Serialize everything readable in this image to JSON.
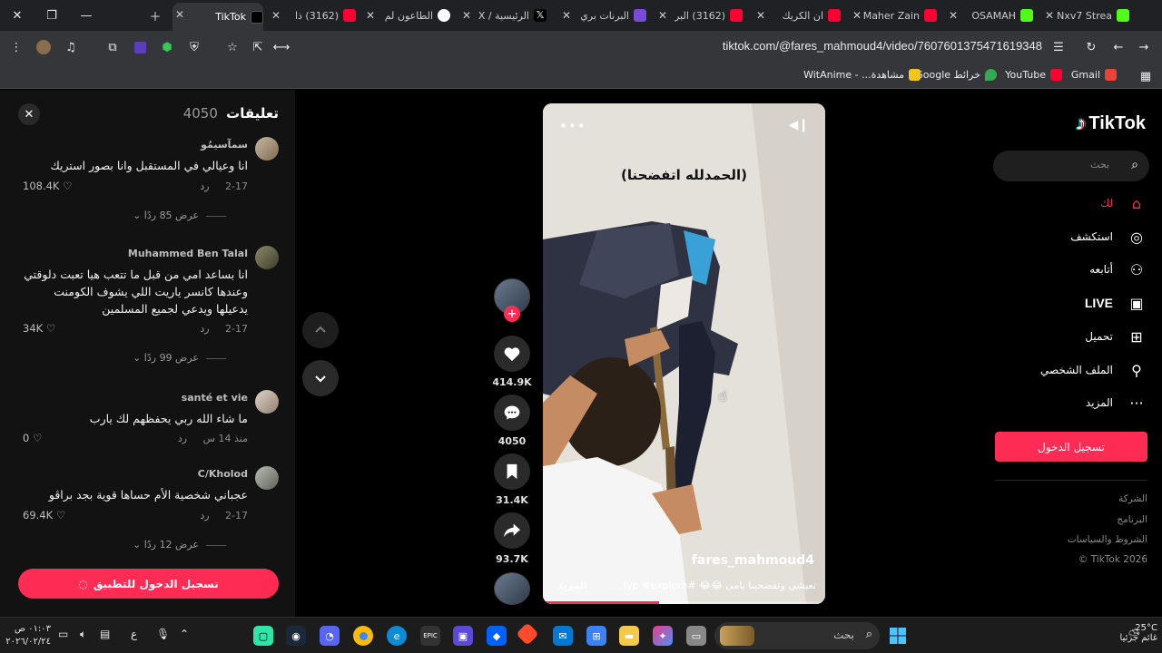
{
  "browser": {
    "tabs": [
      {
        "title": "Nxv7 Strea",
        "color": "#53fc18"
      },
      {
        "title": "OSAMAH",
        "color": "#53fc18"
      },
      {
        "title": "Maher Zain",
        "color": "#ff0033"
      },
      {
        "title": "ان الكريك",
        "color": "#ff0033"
      },
      {
        "title": "(3162) البر",
        "color": "#ff0033"
      },
      {
        "title": "البرنات بري",
        "color": "#7a4bd8"
      },
      {
        "title": "الرئيسية / X",
        "color": "#ffffff"
      },
      {
        "title": "الطاعون لم",
        "color": "#4285f4"
      },
      {
        "title": "(3162) ذا",
        "color": "#ff0033"
      },
      {
        "title": "TikTok",
        "color": "#000000"
      }
    ],
    "active_tab": "TikTok",
    "url": "tiktok.com/@fares_mahmoud4/video/7607601375471619348",
    "bookmarks": [
      {
        "label": "Gmail",
        "color": "#ea4335"
      },
      {
        "label": "YouTube",
        "color": "#ff0033"
      },
      {
        "label": "خرائط Google",
        "color": "#34a853"
      },
      {
        "label": "مشاهدة... - WitAnime",
        "color": "#f5c518"
      }
    ]
  },
  "comments_panel": {
    "title": "تعليقات",
    "count": "4050",
    "comments": [
      {
        "user": "سمآسيمُو",
        "text": "انا وعيالي في المستقبل وانا بصور استريك",
        "date": "2-17",
        "reply": "رد",
        "likes": "108.4K",
        "replies": "عرض 85 ردًا"
      },
      {
        "user": "Muhammed Ben Talal",
        "text": "انا بساعد امي من قبل ما تتعب هيا تعبت دلوقتي وعندها كانسر ياريت اللي يشوف الكومنت يدعيلها ويدعي لجميع المسلمين",
        "date": "2-17",
        "reply": "رد",
        "likes": "34K",
        "replies": "عرض 99 ردًا"
      },
      {
        "user": "santé et vie",
        "text": "ما شاء الله ربي يحفظهم لك يارب",
        "date": "منذ 14 س",
        "reply": "رد",
        "likes": "0",
        "replies": ""
      },
      {
        "user": "C/Kholod",
        "text": "عجباني شخصية الأم حساها قوية بجد براڤو",
        "date": "2-17",
        "reply": "رد",
        "likes": "69.4K",
        "replies": "عرض 12 ردًا"
      }
    ],
    "login_app": "تسجيل الدخول للتطبيق"
  },
  "video": {
    "top_caption": "(الحمدلله اتفضحنا)",
    "author": "fares_mahmoud4",
    "description": "تعيشى وتفضحينا يامى 😂😂 #fyp #explore ...",
    "more": "المزيد",
    "progress_fraction": 0.41
  },
  "actions": {
    "likes": "414.9K",
    "comments": "4050",
    "saves": "31.4K",
    "shares": "93.7K"
  },
  "nav": {
    "logo": "TikTok",
    "search_placeholder": "بحث",
    "items": [
      {
        "label": "لك",
        "icon": "home-icon",
        "active": true
      },
      {
        "label": "استكشف",
        "icon": "compass-icon",
        "active": false
      },
      {
        "label": "أتابعه",
        "icon": "following-icon",
        "active": false
      },
      {
        "label": "LIVE",
        "icon": "live-icon",
        "active": false
      },
      {
        "label": "تحميل",
        "icon": "upload-icon",
        "active": false
      },
      {
        "label": "الملف الشخصي",
        "icon": "profile-icon",
        "active": false
      },
      {
        "label": "المزيد",
        "icon": "more-icon",
        "active": false
      }
    ],
    "login": "تسجيل الدخول",
    "footer": [
      "الشركة",
      "البرنامج",
      "الشروط والسياسات",
      "© TikTok 2026"
    ]
  },
  "taskbar": {
    "search_placeholder": "بحث",
    "weather_temp": "25°C",
    "weather_desc": "غائم جزئيا",
    "time": "٠١:٠٣ ص",
    "date": "٢٠٢٦/٠٢/٢٤",
    "lang": "ع"
  }
}
